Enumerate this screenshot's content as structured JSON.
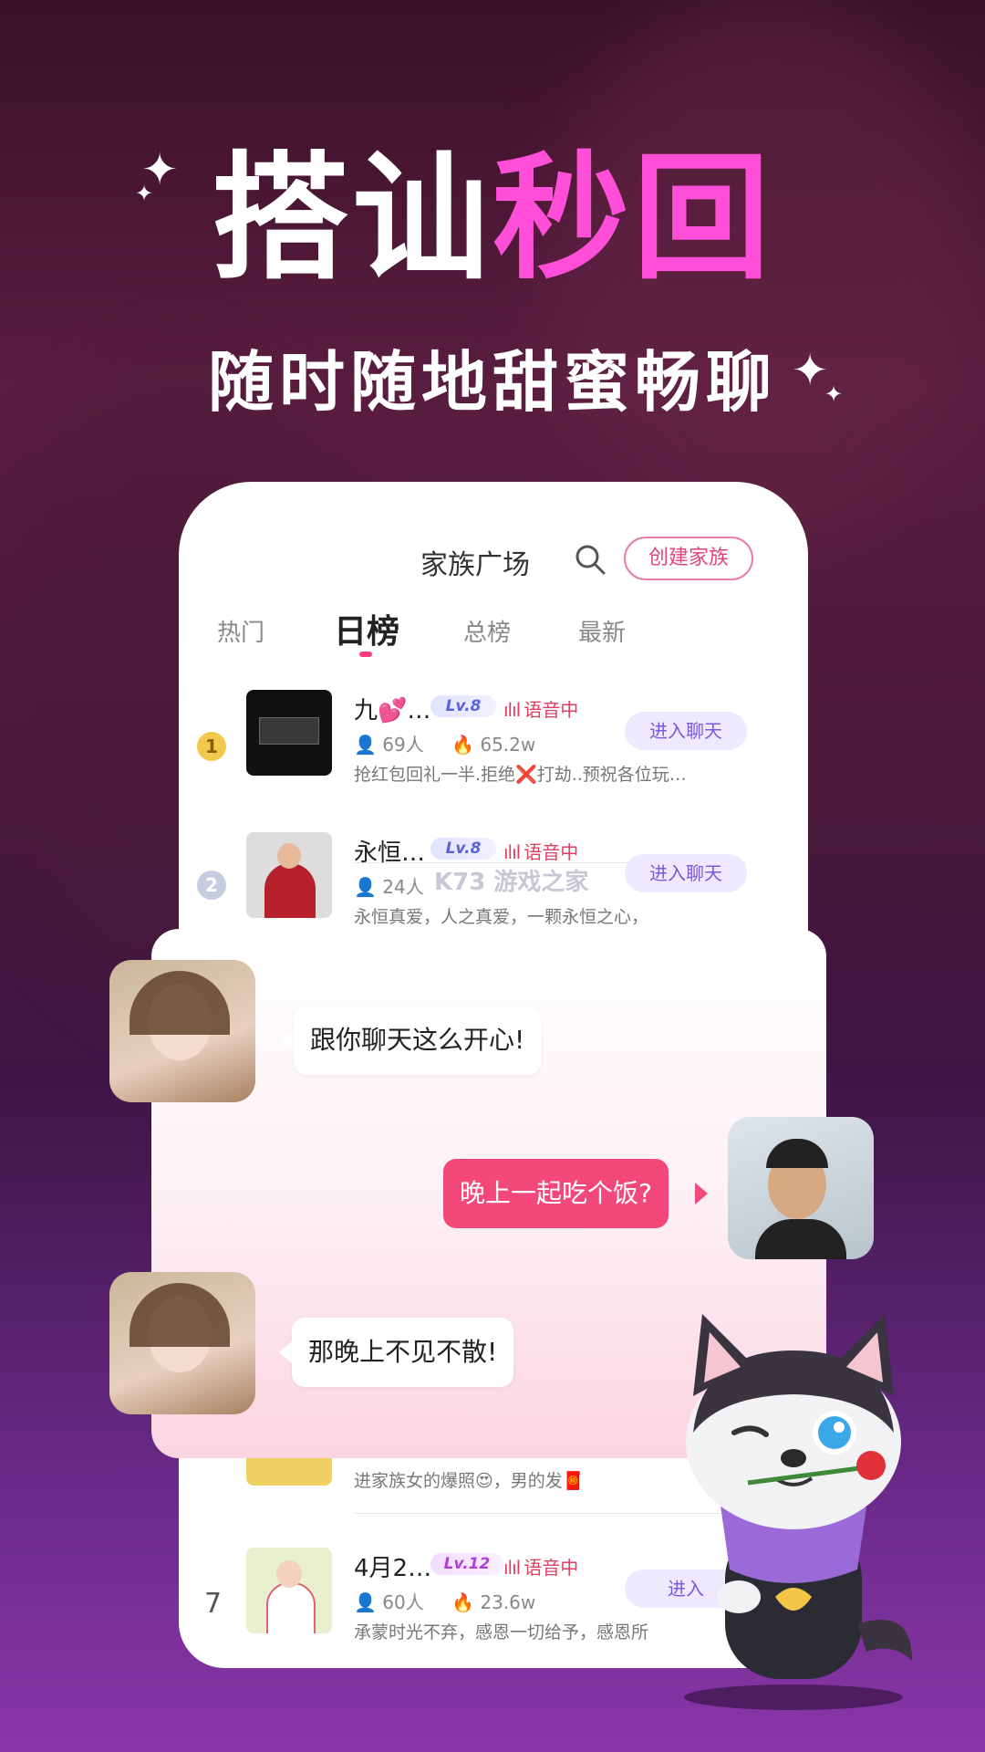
{
  "headline": {
    "white": "搭讪",
    "pink": "秒回"
  },
  "subline": "随时随地甜蜜畅聊",
  "app": {
    "title": "家族广场",
    "create_label": "创建家族",
    "tabs": [
      {
        "label": "热门"
      },
      {
        "label": "日榜"
      },
      {
        "label": "总榜"
      },
      {
        "label": "最新"
      }
    ],
    "rows": [
      {
        "rank": "1",
        "name": "九💕…",
        "level": "Lv.8",
        "status": "语音中",
        "members": "69人",
        "heat": "65.2w",
        "desc": "抢红包回礼一半.拒绝❌打劫..预祝各位玩…",
        "enter": "进入聊天"
      },
      {
        "rank": "2",
        "name": "永恒…",
        "level": "Lv.8",
        "status": "语音中",
        "members": "24人",
        "heat": "",
        "desc": "永恒真爱，人之真爱，一颗永恒之心，",
        "enter": "进入聊天"
      },
      {
        "rank": "",
        "name": "",
        "level": "",
        "status": "",
        "members": "",
        "heat": "",
        "desc": "进家族女的爆照😍，男的发🧧",
        "enter": ""
      },
      {
        "rank": "7",
        "name": "4月2…",
        "level": "Lv.12",
        "status": "语音中",
        "members": "60人",
        "heat": "23.6w",
        "desc": "承蒙时光不弃，感恩一切给予，感恩所",
        "enter": "进入"
      }
    ]
  },
  "chat": {
    "messages": [
      {
        "side": "left",
        "text": "跟你聊天这么开心!"
      },
      {
        "side": "right",
        "text": "晚上一起吃个饭?"
      },
      {
        "side": "left",
        "text": "那晚上不见不散!"
      }
    ]
  },
  "watermark": "K73 游戏之家",
  "colors": {
    "accent_pink": "#ff4fd8",
    "bubble_pink": "#f2487a",
    "bg_purple": "#5a1d3f"
  }
}
